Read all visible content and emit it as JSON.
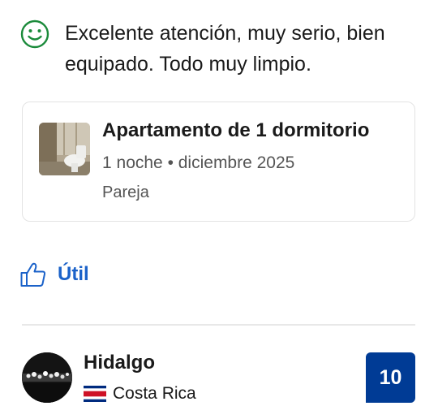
{
  "review": {
    "positive_text": "Excelente atención, muy serio, bien equipado. Todo muy limpio.",
    "positive_icon": "smile-icon"
  },
  "stay": {
    "room_name": "Apartamento de 1 dormitorio",
    "stay_details": "1 noche • diciembre 2025",
    "traveler_type": "Pareja"
  },
  "actions": {
    "helpful_label": "Útil",
    "helpful_icon": "thumbs-up-icon"
  },
  "next_review": {
    "reviewer_name": "Hidalgo",
    "country": "Costa Rica",
    "score": "10"
  },
  "colors": {
    "positive_green": "#1a8a3a",
    "link_blue": "#1b62c9",
    "score_badge_bg": "#003b95"
  }
}
